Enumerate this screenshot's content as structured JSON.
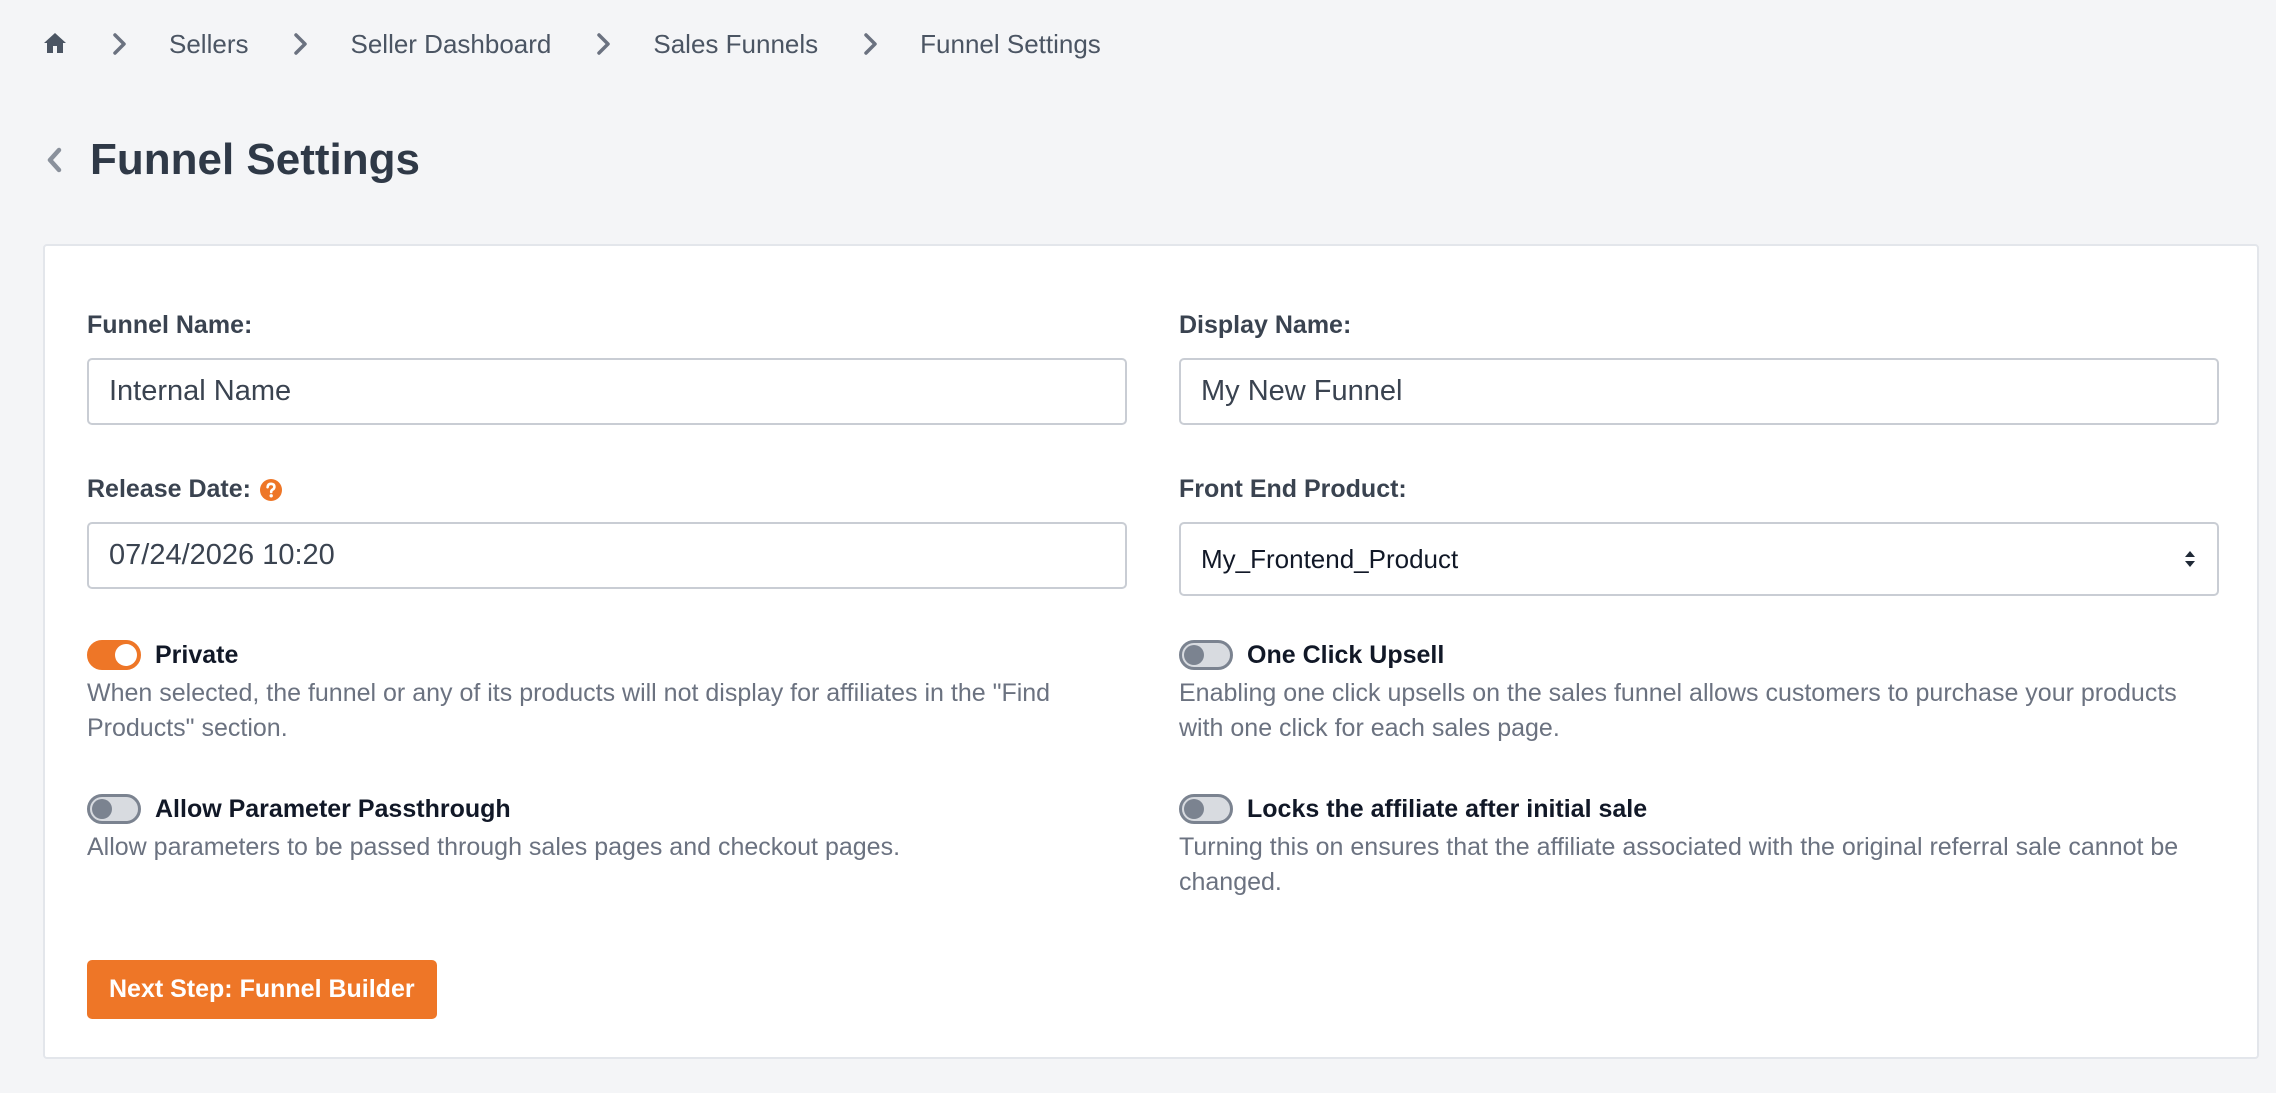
{
  "breadcrumb": {
    "home_icon": "home-icon",
    "separator_icon": "chevron-right-icon",
    "items": [
      {
        "label": "Sellers"
      },
      {
        "label": "Seller Dashboard"
      },
      {
        "label": "Sales Funnels"
      },
      {
        "label": "Funnel Settings"
      }
    ]
  },
  "header": {
    "back_icon": "chevron-left-icon",
    "title": "Funnel Settings"
  },
  "form": {
    "funnel_name": {
      "label": "Funnel Name:",
      "value": "Internal Name"
    },
    "display_name": {
      "label": "Display Name:",
      "value": "My New Funnel"
    },
    "release_date": {
      "label": "Release Date:",
      "value": "07/24/2026 10:20",
      "help_icon": "question-circle-icon"
    },
    "front_end_product": {
      "label": "Front End Product:",
      "selected": "My_Frontend_Product",
      "arrow_icon": "sort-arrows-icon"
    }
  },
  "toggles": {
    "private": {
      "label": "Private",
      "checked": true,
      "description": "When selected, the funnel or any of its products will not display for affiliates in the \"Find Products\" section."
    },
    "one_click_upsell": {
      "label": "One Click Upsell",
      "checked": false,
      "description": "Enabling one click upsells on the sales funnel allows customers to purchase your products with one click for each sales page."
    },
    "parameter_passthrough": {
      "label": "Allow Parameter Passthrough",
      "checked": false,
      "description": "Allow parameters to be passed through sales pages and checkout pages."
    },
    "lock_affiliate": {
      "label": "Locks the affiliate after initial sale",
      "checked": false,
      "description": "Turning this on ensures that the affiliate associated with the original referral sale cannot be changed."
    }
  },
  "actions": {
    "next_step_label": "Next Step: Funnel Builder"
  },
  "colors": {
    "accent": "#ee7627",
    "page_background": "#f4f5f7",
    "card_background": "#ffffff",
    "muted_text": "#6b7280",
    "toggle_off": "#7b8390"
  }
}
